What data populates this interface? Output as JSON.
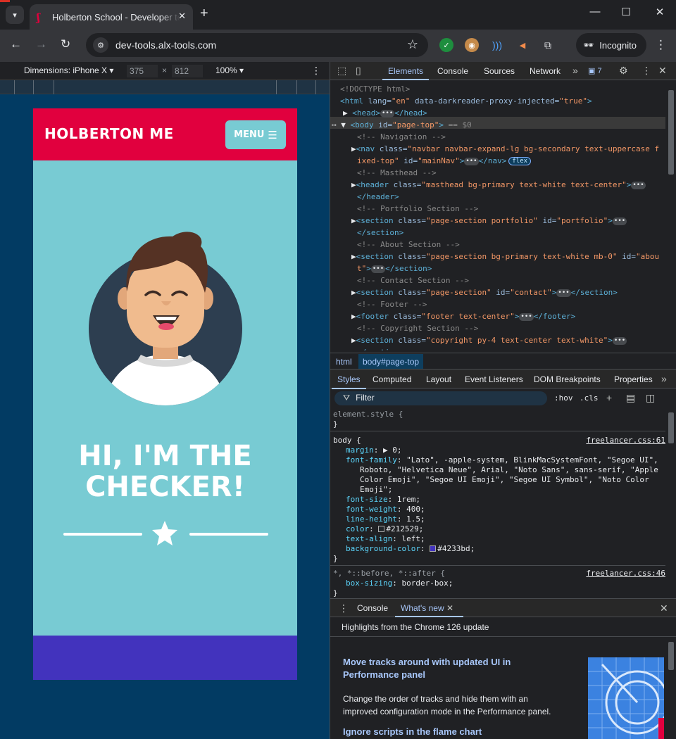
{
  "browser": {
    "tab_title": "Holberton School - Developer tools",
    "tab_search_icon": "▾",
    "new_tab": "+",
    "url": "dev-tools.alx-tools.com",
    "incognito_label": "Incognito",
    "minimize": "—",
    "maximize": "☐",
    "close": "✕"
  },
  "device_toolbar": {
    "dimensions": "Dimensions: iPhone X",
    "width": "375",
    "height": "812",
    "zoom": "100%",
    "times": "×"
  },
  "page": {
    "brand": "HOLBERTON ME",
    "menu_label": "MENU",
    "menu_icon": "☰",
    "hero_line1": "HI, I'M THE",
    "hero_line2": "CHECKER!",
    "colors": {
      "navbar": "#e1003e",
      "masthead": "#78cbd3",
      "about": "#4233bd"
    }
  },
  "devtools": {
    "tabs": [
      "Elements",
      "Console",
      "Sources",
      "Network"
    ],
    "issues_count": "7",
    "dom": {
      "doctype": "<!DOCTYPE html>",
      "html_open": "<html",
      "html_lang_attr": " lang=",
      "html_lang_val": "\"en\"",
      "html_dr_attr": " data-darkreader-proxy-injected=",
      "html_dr_val": "\"true\"",
      "head": "<head>",
      "head_close": "</head>",
      "body_open": "<body",
      "body_id_attr": " id=",
      "body_id_val": "\"page-top\"",
      "body_suffix": " == $0",
      "c_nav": "<!-- Navigation -->",
      "nav_tag": "<nav",
      "nav_class_attr": " class=",
      "nav_class_val1": "\"navbar navbar-expand-lg bg-secondary text-uppercase f",
      "nav_class_val2": "ixed-top\"",
      "nav_id_attr": " id=",
      "nav_id_val": "\"mainNav\"",
      "nav_close": "</nav>",
      "flex_badge": "flex",
      "c_masthead": "<!-- Masthead -->",
      "header_tag": "<header",
      "header_class_attr": " class=",
      "header_class_val": "\"masthead bg-primary text-white text-center\"",
      "header_close": "</header>",
      "c_portfolio": "<!-- Portfolio Section -->",
      "section_tag": "<section",
      "portfolio_class_val": "\"page-section portfolio\"",
      "portfolio_id_val": "\"portfolio\"",
      "section_close": "</section>",
      "c_about": "<!-- About Section -->",
      "about_class_val": "\"page-section bg-primary text-white mb-0\"",
      "about_id_val1": "\"abou",
      "about_id_val2": "t\"",
      "c_contact": "<!-- Contact Section -->",
      "contact_class_val": "\"page-section\"",
      "contact_id_val": "\"contact\"",
      "c_footer": "<!-- Footer -->",
      "footer_tag": "<footer",
      "footer_class_val": "\"footer text-center\"",
      "footer_close": "</footer>",
      "c_copyright": "<!-- Copyright Section -->",
      "copyright_class_val": "\"copyright py-4 text-center text-white\"",
      "ellipsis": "•••",
      "gt": ">",
      "class_attr": " class=",
      "id_attr": " id="
    },
    "breadcrumbs": [
      "html",
      "body#page-top"
    ],
    "styles_tabs": [
      "Styles",
      "Computed",
      "Layout",
      "Event Listeners",
      "DOM Breakpoints",
      "Properties"
    ],
    "filter_placeholder": "Filter",
    "hov": ":hov",
    "cls": ".cls",
    "styles": {
      "element_style": "element.style {",
      "close_brace": "}",
      "body_selector": "body {",
      "body_source": "freelancer.css:61",
      "margin_prop": "margin",
      "margin_val": "0;",
      "ff_prop": "font-family",
      "ff_val1": "\"Lato\", -apple-system, BlinkMacSystemFont, \"Segoe UI\",",
      "ff_val2": "Roboto, \"Helvetica Neue\", Arial, \"Noto Sans\", sans-serif, \"Apple",
      "ff_val3": "Color Emoji\", \"Segoe UI Emoji\", \"Segoe UI Symbol\", \"Noto Color",
      "ff_val4": "Emoji\";",
      "fs_prop": "font-size",
      "fs_val": "1rem;",
      "fw_prop": "font-weight",
      "fw_val": "400;",
      "lh_prop": "line-height",
      "lh_val": "1.5;",
      "color_prop": "color",
      "color_val": "#212529;",
      "color_swatch": "#212529",
      "ta_prop": "text-align",
      "ta_val": "left;",
      "bg_prop": "background-color",
      "bg_val": "#4233bd;",
      "bg_swatch": "#4233bd",
      "universal_selector": "*, *::before, *::after {",
      "universal_source": "freelancer.css:46",
      "bs_prop": "box-sizing",
      "bs_val": "border-box;"
    },
    "drawer": {
      "tabs": [
        "Console",
        "What's new"
      ],
      "highlights": "Highlights from the Chrome 126 update",
      "item1_title": "Move tracks around with updated UI in Performance panel",
      "item1_desc": "Change the order of tracks and hide them with an improved configuration mode in the Performance panel.",
      "item2_title": "Ignore scripts in the flame chart"
    }
  }
}
